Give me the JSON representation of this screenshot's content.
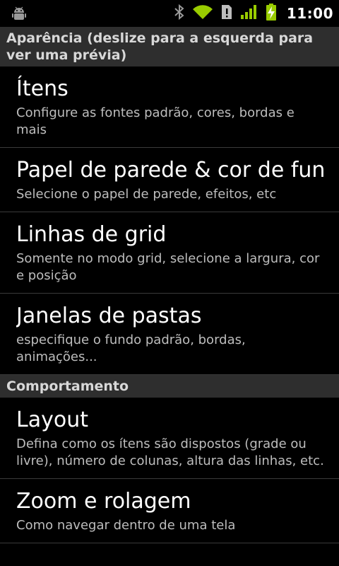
{
  "status_bar": {
    "time": "11:00",
    "icons": [
      "android-debug-icon",
      "bluetooth-icon",
      "wifi-icon",
      "sd-card-alert-icon",
      "signal-icon",
      "battery-charging-icon"
    ],
    "accent_color": "#99cc00"
  },
  "sections": [
    {
      "header": "Aparência (deslize para a esquerda para ver uma prévia)",
      "items": [
        {
          "title": "Ítens",
          "summary": "Configure as fontes padrão, cores, bordas e mais"
        },
        {
          "title": "Papel de parede & cor de fundo",
          "summary": "Selecione o papel de parede, efeitos, etc"
        },
        {
          "title": "Linhas de grid",
          "summary": "Somente no modo grid, selecione a largura, cor e posição"
        },
        {
          "title": "Janelas de pastas",
          "summary": "especifique o fundo padrão, bordas, animações..."
        }
      ]
    },
    {
      "header": "Comportamento",
      "items": [
        {
          "title": "Layout",
          "summary": "Defina como os ítens são dispostos (grade ou livre), número de colunas, altura das linhas, etc."
        },
        {
          "title": "Zoom e rolagem",
          "summary": "Como navegar dentro de uma tela"
        }
      ]
    }
  ]
}
